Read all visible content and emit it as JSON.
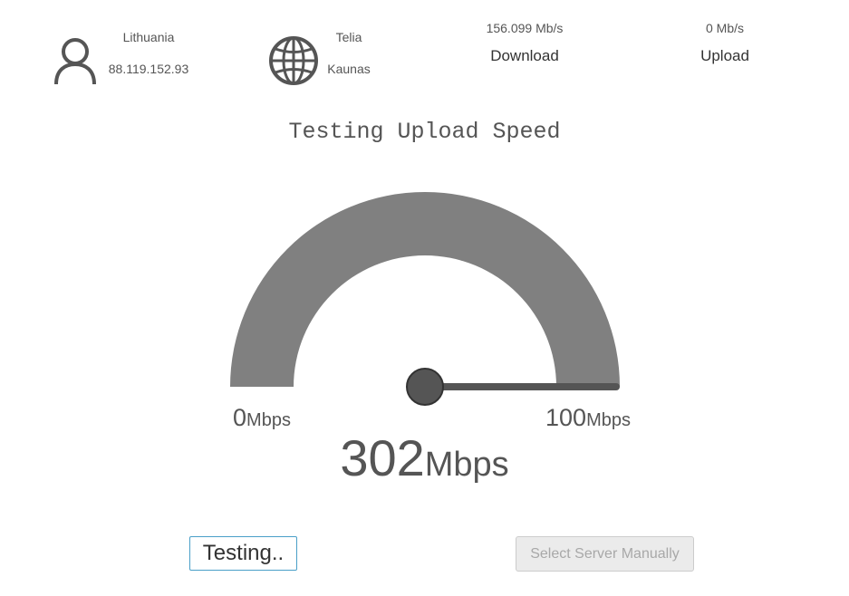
{
  "client": {
    "country": "Lithuania",
    "ip": "88.119.152.93",
    "icon": "user-icon"
  },
  "server": {
    "provider": "Telia",
    "city": "Kaunas",
    "icon": "globe-icon"
  },
  "download": {
    "value": "156.099 Mb/s",
    "label": "Download"
  },
  "upload": {
    "value": "0 Mb/s",
    "label": "Upload"
  },
  "status_title": "Testing Upload Speed",
  "gauge": {
    "min": "0",
    "min_unit": "Mbps",
    "max": "100",
    "max_unit": "Mbps",
    "needle_value": 100,
    "fill_color": "#808080",
    "needle_color": "#555555"
  },
  "speed": {
    "value": "302",
    "unit": "Mbps"
  },
  "buttons": {
    "test": "Testing..",
    "select_server": "Select Server Manually"
  }
}
